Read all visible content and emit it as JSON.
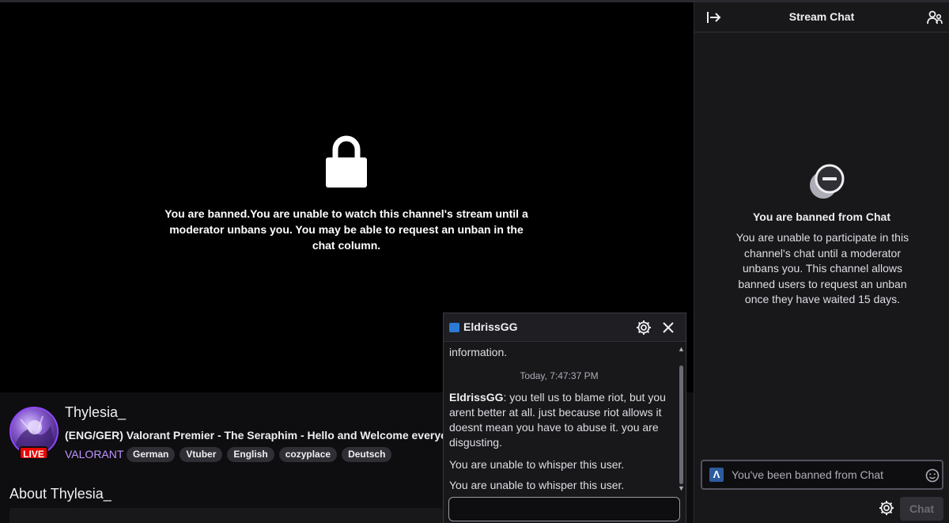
{
  "player": {
    "ban_message": "You are banned.You are unable to watch this channel's stream until a moderator unbans you. You may be able to request an unban in the chat column.",
    "lock_icon": "lock-icon"
  },
  "channel": {
    "name": "Thylesia_",
    "live_label": "LIVE",
    "title": "(ENG/GER) Valorant Premier - The Seraphim - Hello and Welcome everyone",
    "game": "VALORANT",
    "tags": [
      "German",
      "Vtuber",
      "English",
      "cozyplace",
      "Deutsch"
    ],
    "about_heading": "About Thylesia_"
  },
  "chat": {
    "title": "Stream Chat",
    "banned_title": "You are banned from Chat",
    "banned_text": "You are unable to participate in this channel's chat until a moderator unbans you. This channel allows banned users to request an unban once they have waited 15 days.",
    "input_placeholder": "You've been banned from Chat",
    "send_label": "Chat"
  },
  "whisper": {
    "username": "EldrissGG",
    "prev_tail": "information.",
    "timestamp": "Today, 7:47:37 PM",
    "message_author": "EldrissGG",
    "message_text": ": you tell us to blame riot, but you arent better at all. just because riot allows it doesnt mean you have to abuse it. you are disgusting.",
    "notice_1": "You are unable to whisper this user.",
    "notice_2": "You are unable to whisper this user."
  },
  "colors": {
    "accent": "#9147ff",
    "game_link": "#bf94ff",
    "live": "#eb0400",
    "background": "#0e0e10",
    "panel": "#18181b"
  }
}
